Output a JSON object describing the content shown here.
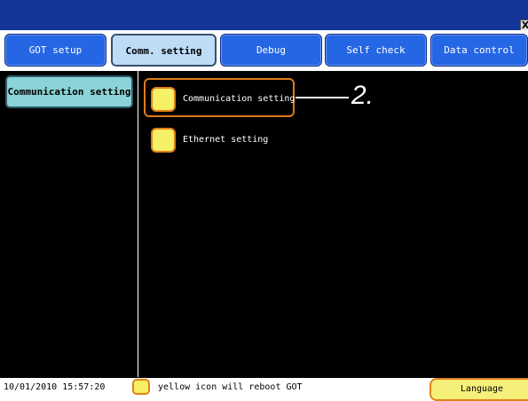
{
  "window": {
    "close_label": "X"
  },
  "tabs": [
    {
      "label": "GOT setup"
    },
    {
      "label": "Comm. setting"
    },
    {
      "label": "Debug"
    },
    {
      "label": "Self check"
    },
    {
      "label": "Data control"
    }
  ],
  "sidebar": {
    "items": [
      {
        "label": "Communication setting"
      }
    ]
  },
  "main": {
    "items": [
      {
        "label": "Communication setting",
        "icon": "yellow-square-icon"
      },
      {
        "label": "Ethernet setting",
        "icon": "yellow-square-icon"
      }
    ],
    "callout": "2."
  },
  "status": {
    "datetime": "10/01/2010 15:57:20",
    "note": "yellow icon will reboot GOT",
    "language_button": "Language"
  },
  "colors": {
    "titlebar": "#14359a",
    "tab": "#2566e4",
    "tab_active": "#bfdcf7",
    "sidebar_active": "#8bd3d6",
    "icon_fill": "#f5f065",
    "icon_border": "#e0801a"
  }
}
